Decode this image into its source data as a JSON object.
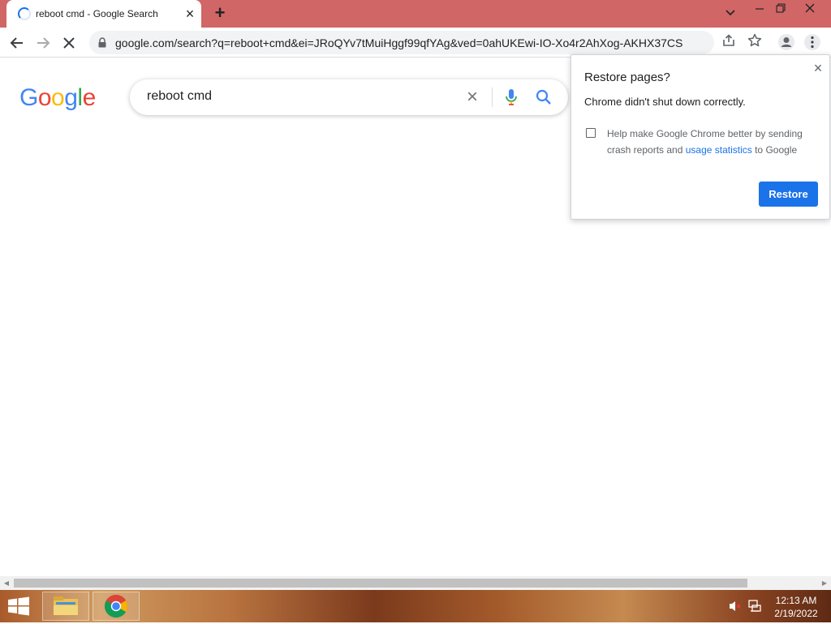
{
  "browser": {
    "tab": {
      "title": "reboot cmd - Google Search",
      "close_icon": "×"
    },
    "new_tab_icon": "+",
    "window_controls": {
      "chevron": "⌄",
      "minimize": "–",
      "restore": "❐",
      "close": "✕"
    },
    "url": "google.com/search?q=reboot+cmd&ei=JRoQYv7tMuiHggf99qfYAg&ved=0ahUKEwi-IO-Xo4r2AhXog-AKHX37CSsQ4..."
  },
  "google": {
    "logo_letters": [
      {
        "char": "G",
        "color": "#4285F4"
      },
      {
        "char": "o",
        "color": "#EA4335"
      },
      {
        "char": "o",
        "color": "#FBBC05"
      },
      {
        "char": "g",
        "color": "#4285F4"
      },
      {
        "char": "l",
        "color": "#34A853"
      },
      {
        "char": "e",
        "color": "#EA4335"
      }
    ],
    "query": "reboot cmd",
    "clear_icon": "×"
  },
  "restore_bubble": {
    "title": "Restore pages?",
    "message": "Chrome didn't shut down correctly.",
    "checkbox_text_before": "Help make Google Chrome better by sending crash reports and ",
    "checkbox_link": "usage statistics",
    "checkbox_text_after": " to Google",
    "checked": false,
    "restore_label": "Restore",
    "close_icon": "×"
  },
  "taskbar": {
    "time": "12:13 AM",
    "date": "2/19/2022"
  },
  "colors": {
    "tabstrip": "#d16666",
    "accent": "#1a73e8"
  }
}
